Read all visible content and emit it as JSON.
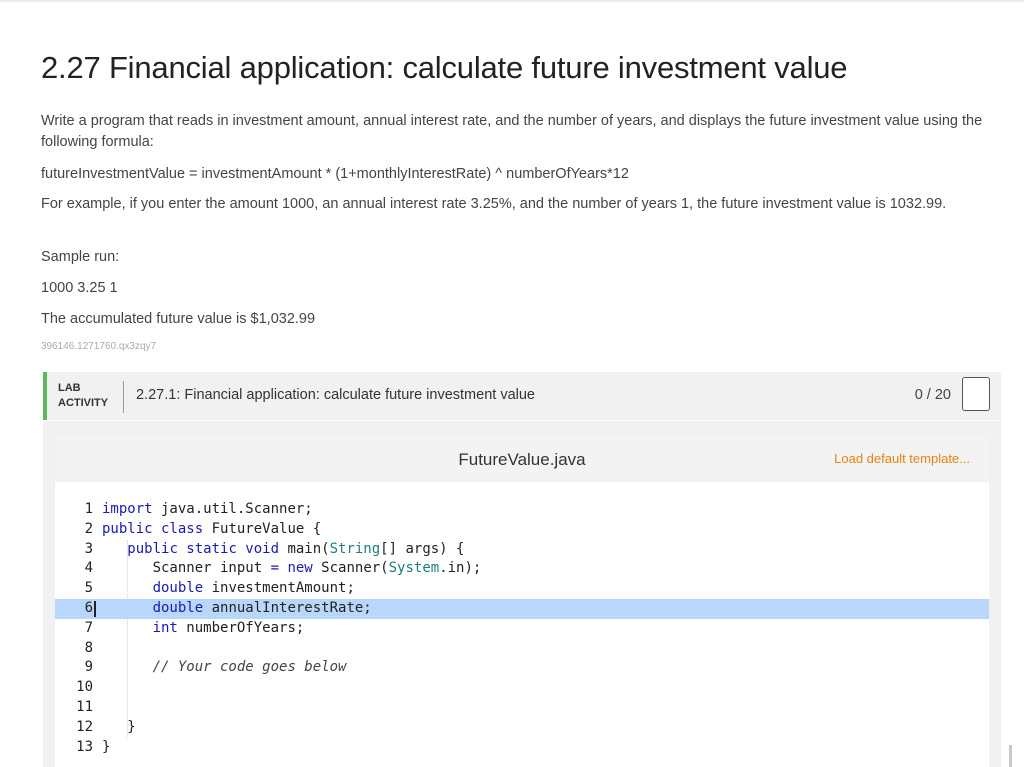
{
  "problem": {
    "title": "2.27 Financial application: calculate future investment value",
    "description": "Write a program that reads in investment amount, annual interest rate, and the number of years, and displays the future investment value using the following formula:",
    "formula": "futureInvestmentValue = investmentAmount * (1+monthlyInterestRate) ^ numberOfYears*12",
    "example": "For example, if you enter the amount 1000, an annual interest rate 3.25%, and the number of years 1, the future investment value is 1032.99.",
    "sample_run_label": "Sample run:",
    "sample_input": "1000 3.25 1",
    "sample_output": "The accumulated future value is $1,032.99",
    "content_id": "396146.1271760.qx3zqy7"
  },
  "lab": {
    "label_line1": "LAB",
    "label_line2": "ACTIVITY",
    "title": "2.27.1: Financial application: calculate future investment value",
    "score": "0 / 20",
    "accent_color": "#5cb85c"
  },
  "editor": {
    "filename": "FutureValue.java",
    "load_template_label": "Load default template...",
    "active_line": 6,
    "line_numbers": [
      "1",
      "2",
      "3",
      "4",
      "5",
      "6",
      "7",
      "8",
      "9",
      "10",
      "11",
      "12",
      "13"
    ],
    "lines": [
      [
        {
          "t": "import",
          "c": "kw"
        },
        {
          "t": " java.util.Scanner;"
        }
      ],
      [
        {
          "t": "public class",
          "c": "kw"
        },
        {
          "t": " FutureValue {"
        }
      ],
      [
        {
          "t": "   "
        },
        {
          "t": "public static void",
          "c": "kw"
        },
        {
          "t": " main("
        },
        {
          "t": "String",
          "c": "cls"
        },
        {
          "t": "[] args) {"
        }
      ],
      [
        {
          "t": "      Scanner input "
        },
        {
          "t": "=",
          "c": "op"
        },
        {
          "t": " "
        },
        {
          "t": "new",
          "c": "kw"
        },
        {
          "t": " Scanner("
        },
        {
          "t": "System",
          "c": "cls"
        },
        {
          "t": ".in);"
        }
      ],
      [
        {
          "t": "      "
        },
        {
          "t": "double",
          "c": "ty"
        },
        {
          "t": " investmentAmount;"
        }
      ],
      [
        {
          "t": "      "
        },
        {
          "t": "double",
          "c": "ty"
        },
        {
          "t": " annualInterestRate;"
        }
      ],
      [
        {
          "t": "      "
        },
        {
          "t": "int",
          "c": "ty"
        },
        {
          "t": " numberOfYears;"
        }
      ],
      [],
      [
        {
          "t": "      "
        },
        {
          "t": "// Your code goes below",
          "c": "cm"
        }
      ],
      [],
      [],
      [
        {
          "t": "   }"
        }
      ],
      [
        {
          "t": "}"
        }
      ]
    ]
  }
}
